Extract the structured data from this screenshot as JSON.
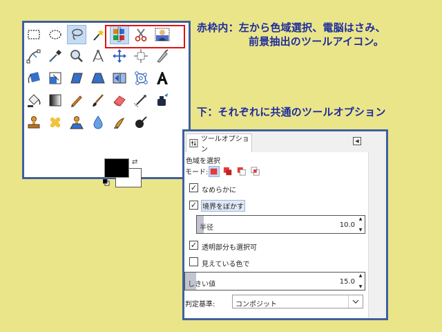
{
  "annotations": {
    "red_box_line1": "赤枠内：左から色域選択、電脳はさみ、",
    "red_box_line2": "前景抽出のツールアイコン。",
    "options_note": "下：それぞれに共通のツールオプション"
  },
  "colors": {
    "background": "#ebe58a",
    "frame_border": "#3f5f9f",
    "annotation_text": "#1c2c9c",
    "highlight_frame": "#e01010",
    "foreground_color": "#000000",
    "background_color": "#ffffff"
  },
  "toolbox": {
    "tools": [
      "rect-select",
      "ellipse-select",
      "free-select",
      "fuzzy-select",
      "select-by-color",
      "scissors-select",
      "foreground-select",
      "paths",
      "color-picker",
      "zoom",
      "measure",
      "move",
      "align",
      "crop",
      "rotate",
      "scale",
      "shear",
      "perspective",
      "flip",
      "cage-transform",
      "text",
      "bucket-fill",
      "blend",
      "pencil",
      "paintbrush",
      "eraser",
      "airbrush",
      "ink",
      "clone",
      "heal",
      "perspective-clone",
      "blur-sharpen",
      "smudge",
      "dodge-burn"
    ],
    "selected_tools": [
      "free-select",
      "select-by-color"
    ]
  },
  "tool_options": {
    "tab_label": "ツールオプション",
    "title": "色域を選択",
    "mode_label": "モード:",
    "mode_buttons": [
      "replace",
      "add",
      "subtract",
      "intersect"
    ],
    "antialias_label": "なめらかに",
    "antialias_checked": true,
    "feather_label": "境界をぼかす",
    "feather_checked": true,
    "radius_label": "半径",
    "radius_value": "10.0",
    "radius_fill": 0.04,
    "transparent_label": "透明部分も選択可",
    "transparent_checked": true,
    "sample_merged_label": "見えている色で",
    "sample_merged_checked": false,
    "threshold_label": "しきい値",
    "threshold_value": "15.0",
    "threshold_fill": 0.06,
    "criterion_label": "判定基準:",
    "criterion_value": "コンポジット",
    "check_mark": "✓",
    "arrow_up": "▲",
    "arrow_down": "▼",
    "menu_glyph": "◀"
  }
}
